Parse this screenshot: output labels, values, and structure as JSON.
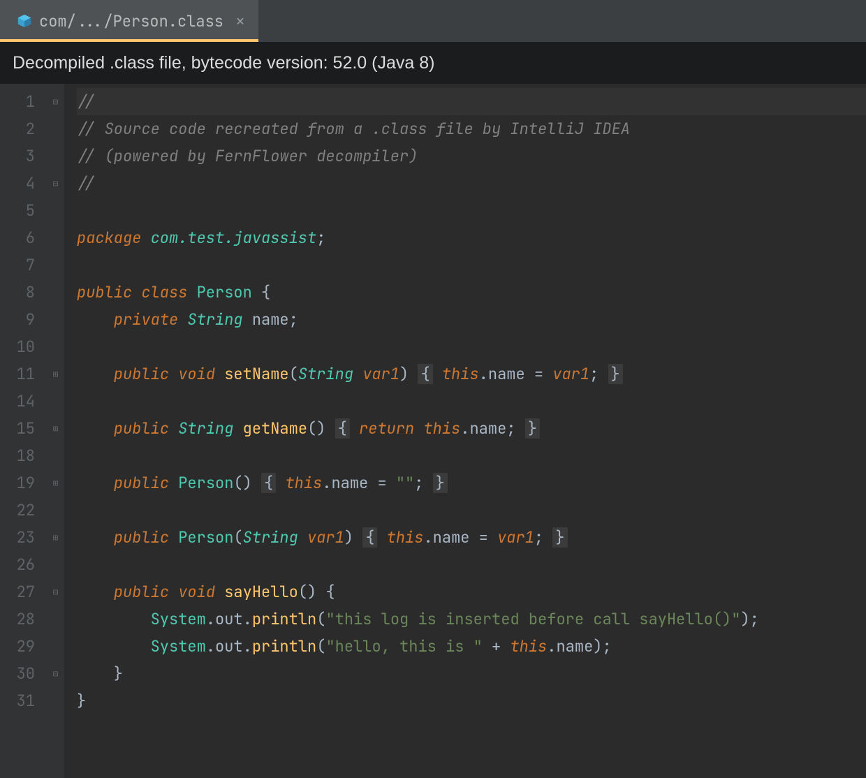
{
  "tab": {
    "label": "com/.../Person.class",
    "icon": "class-file-icon"
  },
  "banner": "Decompiled .class file, bytecode version: 52.0 (Java 8)",
  "lines": [
    {
      "num": "1",
      "fold": "minus",
      "hl": true,
      "tokens": [
        [
          "cm",
          "//"
        ]
      ]
    },
    {
      "num": "2",
      "fold": "",
      "hl": false,
      "tokens": [
        [
          "cm",
          "// Source code recreated from a .class file by IntelliJ IDEA"
        ]
      ]
    },
    {
      "num": "3",
      "fold": "",
      "hl": false,
      "tokens": [
        [
          "cm",
          "// (powered by FernFlower decompiler)"
        ]
      ]
    },
    {
      "num": "4",
      "fold": "minus",
      "hl": false,
      "tokens": [
        [
          "cm",
          "//"
        ]
      ]
    },
    {
      "num": "5",
      "fold": "",
      "hl": false,
      "tokens": []
    },
    {
      "num": "6",
      "fold": "",
      "hl": false,
      "tokens": [
        [
          "kw",
          "package "
        ],
        [
          "typ",
          "com.test.javassist"
        ],
        [
          "punc",
          ";"
        ]
      ]
    },
    {
      "num": "7",
      "fold": "",
      "hl": false,
      "tokens": []
    },
    {
      "num": "8",
      "fold": "",
      "hl": false,
      "tokens": [
        [
          "kw",
          "public class "
        ],
        [
          "typn",
          "Person"
        ],
        [
          "pn",
          " {"
        ]
      ]
    },
    {
      "num": "9",
      "fold": "",
      "hl": false,
      "tokens": [
        [
          "pn",
          "    "
        ],
        [
          "kw",
          "private "
        ],
        [
          "typ",
          "String"
        ],
        [
          "pn",
          " name"
        ],
        [
          "punc",
          ";"
        ]
      ]
    },
    {
      "num": "10",
      "fold": "",
      "hl": false,
      "tokens": []
    },
    {
      "num": "11",
      "fold": "plus",
      "hl": false,
      "tokens": [
        [
          "pn",
          "    "
        ],
        [
          "kw",
          "public void "
        ],
        [
          "fn",
          "setName"
        ],
        [
          "pn",
          "("
        ],
        [
          "typ",
          "String "
        ],
        [
          "prm",
          "var1"
        ],
        [
          "pn",
          ") "
        ],
        [
          "blk",
          "{"
        ],
        [
          "pn",
          " "
        ],
        [
          "kw",
          "this"
        ],
        [
          "pn",
          ".name = "
        ],
        [
          "prm",
          "var1"
        ],
        [
          "punc",
          "; "
        ],
        [
          "blk",
          "}"
        ]
      ]
    },
    {
      "num": "14",
      "fold": "",
      "hl": false,
      "tokens": []
    },
    {
      "num": "15",
      "fold": "plus",
      "hl": false,
      "tokens": [
        [
          "pn",
          "    "
        ],
        [
          "kw",
          "public "
        ],
        [
          "typ",
          "String"
        ],
        [
          "pn",
          " "
        ],
        [
          "fn",
          "getName"
        ],
        [
          "pn",
          "() "
        ],
        [
          "blk",
          "{"
        ],
        [
          "pn",
          " "
        ],
        [
          "kw",
          "return "
        ],
        [
          "kw",
          "this"
        ],
        [
          "pn",
          ".name"
        ],
        [
          "punc",
          "; "
        ],
        [
          "blk",
          "}"
        ]
      ]
    },
    {
      "num": "18",
      "fold": "",
      "hl": false,
      "tokens": []
    },
    {
      "num": "19",
      "fold": "plus",
      "hl": false,
      "tokens": [
        [
          "pn",
          "    "
        ],
        [
          "kw",
          "public "
        ],
        [
          "typn",
          "Person"
        ],
        [
          "pn",
          "() "
        ],
        [
          "blk",
          "{"
        ],
        [
          "pn",
          " "
        ],
        [
          "kw",
          "this"
        ],
        [
          "pn",
          ".name = "
        ],
        [
          "str",
          "\"\""
        ],
        [
          "punc",
          "; "
        ],
        [
          "blk",
          "}"
        ]
      ]
    },
    {
      "num": "22",
      "fold": "",
      "hl": false,
      "tokens": []
    },
    {
      "num": "23",
      "fold": "plus",
      "hl": false,
      "tokens": [
        [
          "pn",
          "    "
        ],
        [
          "kw",
          "public "
        ],
        [
          "typn",
          "Person"
        ],
        [
          "pn",
          "("
        ],
        [
          "typ",
          "String "
        ],
        [
          "prm",
          "var1"
        ],
        [
          "pn",
          ") "
        ],
        [
          "blk",
          "{"
        ],
        [
          "pn",
          " "
        ],
        [
          "kw",
          "this"
        ],
        [
          "pn",
          ".name = "
        ],
        [
          "prm",
          "var1"
        ],
        [
          "punc",
          "; "
        ],
        [
          "blk",
          "}"
        ]
      ]
    },
    {
      "num": "26",
      "fold": "",
      "hl": false,
      "tokens": []
    },
    {
      "num": "27",
      "fold": "minus",
      "hl": false,
      "tokens": [
        [
          "pn",
          "    "
        ],
        [
          "kw",
          "public void "
        ],
        [
          "fn",
          "sayHello"
        ],
        [
          "pn",
          "() {"
        ]
      ]
    },
    {
      "num": "28",
      "fold": "",
      "hl": false,
      "tokens": [
        [
          "pn",
          "        "
        ],
        [
          "typn",
          "System"
        ],
        [
          "pn",
          ".out."
        ],
        [
          "fn",
          "println"
        ],
        [
          "pn",
          "("
        ],
        [
          "str",
          "\"this log is inserted before call sayHello()\""
        ],
        [
          "pn",
          ");"
        ]
      ]
    },
    {
      "num": "29",
      "fold": "",
      "hl": false,
      "tokens": [
        [
          "pn",
          "        "
        ],
        [
          "typn",
          "System"
        ],
        [
          "pn",
          ".out."
        ],
        [
          "fn",
          "println"
        ],
        [
          "pn",
          "("
        ],
        [
          "str",
          "\"hello, this is \""
        ],
        [
          "pn",
          " + "
        ],
        [
          "kw",
          "this"
        ],
        [
          "pn",
          ".name);"
        ]
      ]
    },
    {
      "num": "30",
      "fold": "minus",
      "hl": false,
      "tokens": [
        [
          "pn",
          "    }"
        ]
      ]
    },
    {
      "num": "31",
      "fold": "",
      "hl": false,
      "tokens": [
        [
          "pn",
          "}"
        ]
      ]
    }
  ]
}
